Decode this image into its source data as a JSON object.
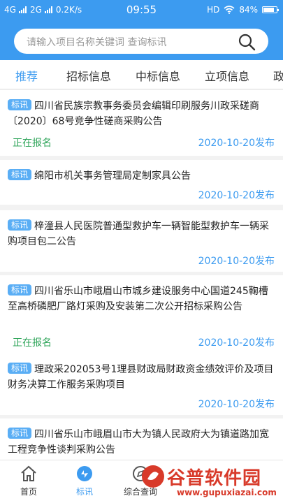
{
  "status_bar": {
    "network_1": "4G",
    "network_2": "2G",
    "speed": "0.2K/s",
    "time": "09:55",
    "hd": "HD",
    "battery_text": "84%",
    "battery_level": 0.84
  },
  "search": {
    "placeholder": "请输入项目名称关键词 查询标讯"
  },
  "tabs": [
    {
      "label": "推荐",
      "active": true
    },
    {
      "label": "招标信息"
    },
    {
      "label": "中标信息"
    },
    {
      "label": "立项信息"
    },
    {
      "label": "政"
    }
  ],
  "badge_label": "标讯",
  "list": [
    {
      "title": "四川省民族宗教事务委员会编辑印刷服务川政采磋商〔2020〕68号竞争性磋商采购公告",
      "status": "正在报名",
      "date": "2020-10-20发布"
    },
    {
      "title": "绵阳市机关事务管理局定制家具公告",
      "status": "",
      "date": "2020-10-20发布"
    },
    {
      "title": "梓潼县人民医院普通型救护车一辆智能型救护车一辆采购项目包二公告",
      "status": "",
      "date": "2020-10-20发布"
    },
    {
      "title": "四川省乐山市峨眉山市城乡建设服务中心国道245鞠槽至高桥磷肥厂路灯采购及安装第二次公开招标采购公告",
      "status": "正在报名",
      "date": "2020-10-20发布"
    },
    {
      "title": "理政采202053号1理县财政局财政资金绩效评价及项目财务决算工作服务采购项目",
      "status": "",
      "date": "2020-10-20发布"
    },
    {
      "title": "四川省乐山市峨眉山市大为镇人民政府大为镇道路加宽工程竞争性谈判采购公告",
      "status": "",
      "date": ""
    }
  ],
  "bottom_nav": [
    {
      "label": "首页",
      "icon": "home-icon"
    },
    {
      "label": "标讯",
      "icon": "bid-news-icon",
      "active": true
    },
    {
      "label": "综合查询",
      "icon": "search-query-icon"
    }
  ],
  "watermark": {
    "brand": "谷普软件园",
    "url": "www.gupuxiazai.com"
  },
  "colors": {
    "primary": "#3c9bf0",
    "status_green": "#2fa55a",
    "badge": "#5aaef5"
  }
}
